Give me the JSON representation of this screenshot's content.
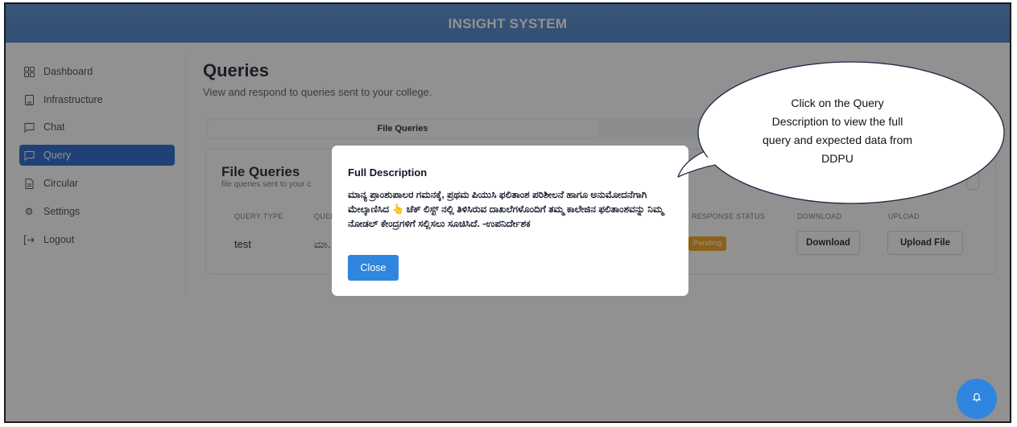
{
  "app": {
    "title": "INSIGHT SYSTEM"
  },
  "sidebar": {
    "items": [
      {
        "label": "Dashboard",
        "icon": "dashboard-icon",
        "active": false
      },
      {
        "label": "Infrastructure",
        "icon": "building-icon",
        "active": false
      },
      {
        "label": "Chat",
        "icon": "chat-icon",
        "active": false
      },
      {
        "label": "Query",
        "icon": "query-icon",
        "active": true
      },
      {
        "label": "Circular",
        "icon": "document-icon",
        "active": false
      },
      {
        "label": "Settings",
        "icon": "gear-icon",
        "active": false
      },
      {
        "label": "Logout",
        "icon": "logout-icon",
        "active": false
      }
    ]
  },
  "main": {
    "title": "Queries",
    "subtitle": "View and respond to queries sent to your college.",
    "tabs": [
      {
        "label": "File Queries",
        "active": true
      }
    ],
    "card": {
      "title": "File Queries",
      "subtitle": "file queries sent to your c",
      "columns": [
        "QUERY TYPE",
        "QUER",
        "RESPONSE STATUS",
        "DOWNLOAD",
        "UPLOAD"
      ],
      "rows": [
        {
          "type": "test",
          "description": "ಮಾ.",
          "status": "Pending",
          "download_label": "Download",
          "upload_label": "Upload File"
        }
      ]
    }
  },
  "modal": {
    "title": "Full Description",
    "body": "ಮಾನ್ಯ ಪ್ರಾಂಶುಪಾಲರ ಗಮನಕ್ಕೆ, ಪ್ರಥಮ ಪಿಯುಸಿ ಫಲಿತಾಂಶ ಪರಿಶೀಲನೆ ಹಾಗೂ ಅನುಮೋದನೆಗಾಗಿ ಮೇಲ್ಕಾಣಿಸಿದ 👆 ಚೆಕ್ ಲಿಸ್ಟ್ ನಲ್ಲಿ ತಿಳಿಸಿರುವ ದಾಖಲೆಗಳೊಂದಿಗೆ ತಮ್ಮ ಕಾಲೇಜಿನ ಫಲಿತಾಂಶವನ್ನು ನಿಮ್ಮ ನೋಡಲ್ ಕೇಂದ್ರಗಳಿಗೆ ಸಲ್ಲಿಸಲು ಸೂಚಿಸಿದೆ. -ಉಪನಿರ್ದೇಶಕ",
    "close_label": "Close"
  },
  "callout": {
    "text": "Click on the Query Description to view the full query and expected data from DDPU"
  },
  "colors": {
    "header": "#4580c9",
    "sidebar_active": "#1b5fc6",
    "primary_button": "#2e86de",
    "pending_badge": "#f59e0b"
  }
}
